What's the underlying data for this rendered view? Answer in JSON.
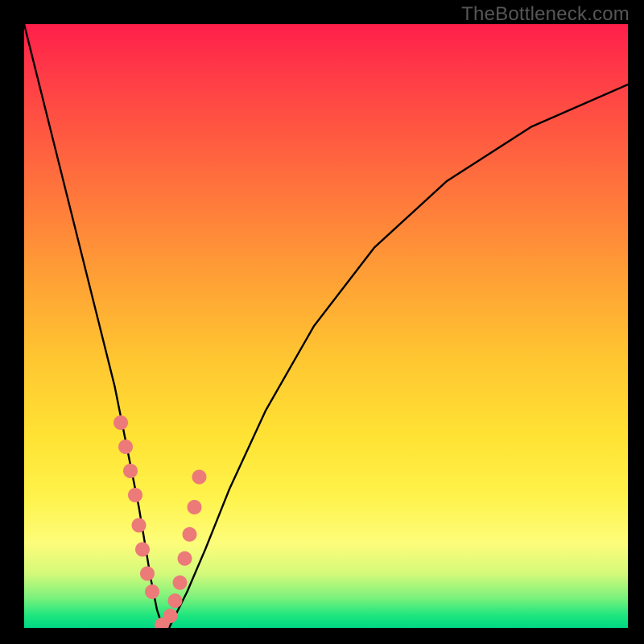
{
  "watermark": "TheBottleneck.com",
  "chart_data": {
    "type": "line",
    "title": "",
    "xlabel": "",
    "ylabel": "",
    "xlim": [
      0,
      100
    ],
    "ylim": [
      0,
      100
    ],
    "legend": false,
    "grid": false,
    "background": {
      "gradient": [
        "#ff1f4a",
        "#ff9a36",
        "#ffe233",
        "#00d884"
      ],
      "direction": "vertical"
    },
    "series": [
      {
        "name": "bottleneck-curve",
        "color": "#000000",
        "x": [
          0,
          3,
          6,
          9,
          12,
          15,
          17,
          19,
          20,
          21,
          22,
          23,
          24,
          25,
          27,
          30,
          34,
          40,
          48,
          58,
          70,
          84,
          100
        ],
        "y": [
          100,
          88,
          76,
          64,
          52,
          40,
          30,
          20,
          14,
          8,
          3,
          0,
          0,
          2,
          6,
          13,
          23,
          36,
          50,
          63,
          74,
          83,
          90
        ]
      }
    ],
    "markers": [
      {
        "name": "highlight-dots",
        "color": "#ec7a79",
        "radius_px": 9,
        "x": [
          16.0,
          16.8,
          17.6,
          18.4,
          19.0,
          19.6,
          20.4,
          21.2,
          22.8,
          24.2,
          25.0,
          25.8,
          26.6,
          27.4,
          28.2,
          29.0
        ],
        "y": [
          34.0,
          30.0,
          26.0,
          22.0,
          17.0,
          13.0,
          9.0,
          6.0,
          0.5,
          2.0,
          4.5,
          7.5,
          11.5,
          15.5,
          20.0,
          25.0
        ]
      }
    ]
  }
}
